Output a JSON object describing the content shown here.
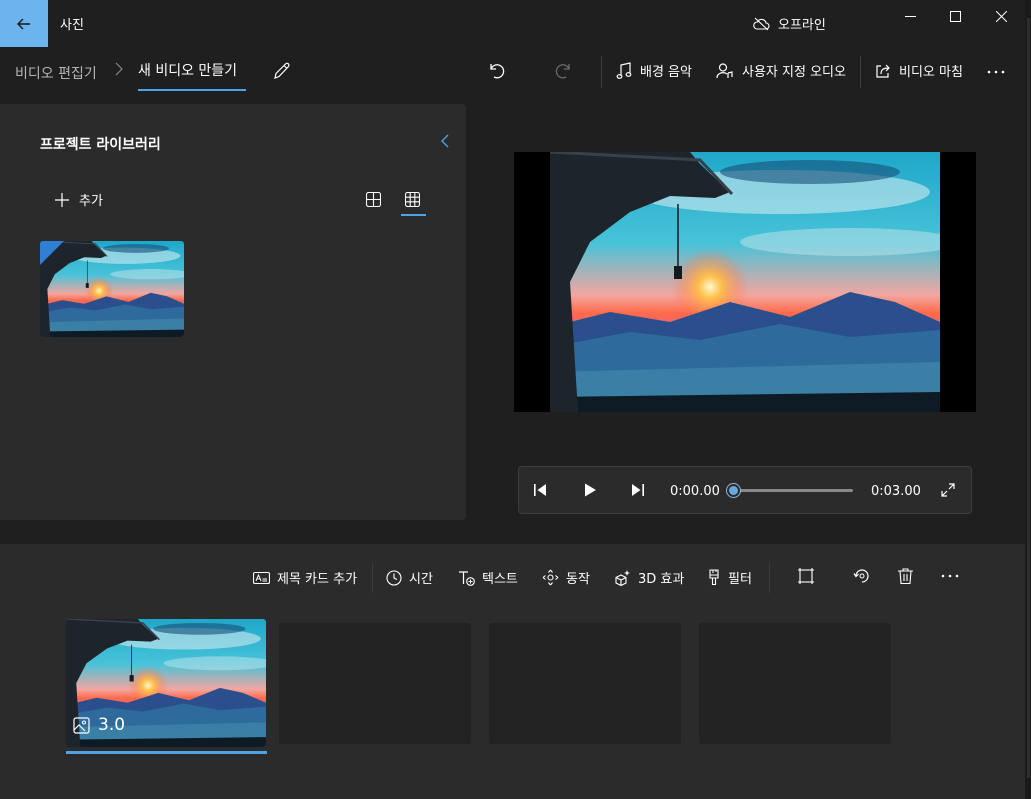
{
  "titlebar": {
    "app_title": "사진",
    "offline_label": "오프라인"
  },
  "commandbar": {
    "breadcrumb_root": "비디오 편집기",
    "breadcrumb_current": "새 비디오 만들기",
    "background_music": "배경 음악",
    "custom_audio": "사용자 지정 오디오",
    "finish_video": "비디오 마침"
  },
  "library": {
    "title": "프로젝트 라이브러리",
    "add_label": "추가"
  },
  "player": {
    "current_time": "0:00.00",
    "total_time": "0:03.00",
    "progress": 0
  },
  "storyboard": {
    "add_title_card": "제목 카드 추가",
    "duration": "시간",
    "text": "텍스트",
    "motion": "동작",
    "effects_3d": "3D 효과",
    "filters": "필터",
    "clips": [
      {
        "duration_label": "3.0"
      }
    ]
  },
  "colors": {
    "accent": "#4ea2e6",
    "back_button": "#6cb4ee",
    "panel": "#2b2b2b",
    "background": "#1f1f1f"
  }
}
